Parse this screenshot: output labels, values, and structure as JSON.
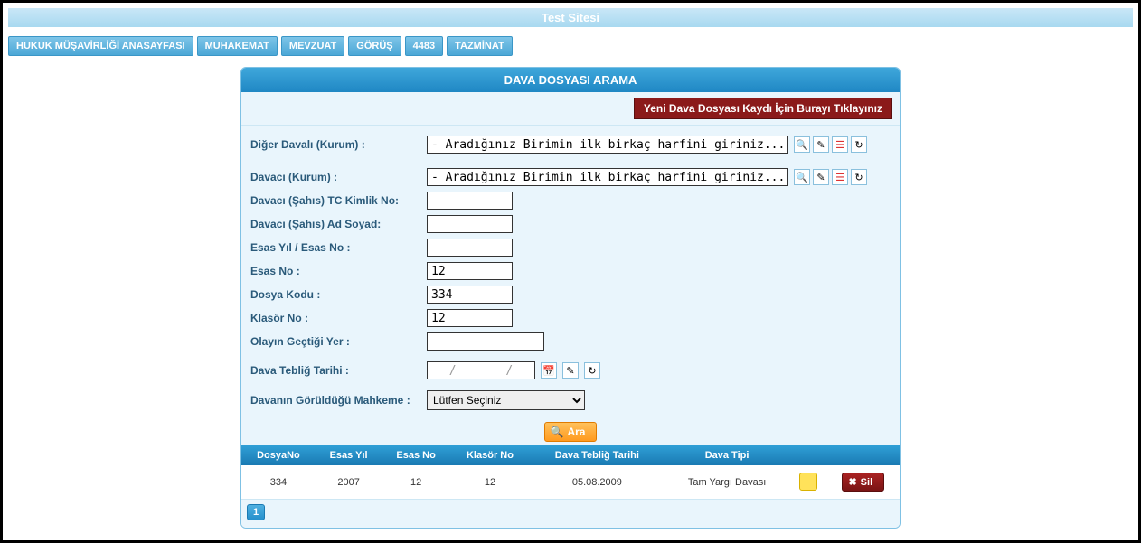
{
  "site_title": "Test Sitesi",
  "nav": [
    "HUKUK MÜŞAVİRLİĞİ ANASAYFASI",
    "MUHAKEMAT",
    "MEVZUAT",
    "GÖRÜŞ",
    "4483",
    "TAZMİNAT"
  ],
  "panel_title": "DAVA DOSYASI ARAMA",
  "new_record_label": "Yeni Dava Dosyası Kaydı İçin Burayı Tıklayınız",
  "form": {
    "diger_davali": {
      "label": "Diğer Davalı (Kurum) :",
      "value": "- Aradığınız Birimin ilk birkaç harfini giriniz..."
    },
    "davaci_kurum": {
      "label": "Davacı (Kurum) :",
      "value": "- Aradığınız Birimin ilk birkaç harfini giriniz..."
    },
    "tc_kimlik": {
      "label": "Davacı (Şahıs) TC Kimlik No:",
      "value": ""
    },
    "ad_soyad": {
      "label": "Davacı (Şahıs) Ad Soyad:",
      "value": ""
    },
    "esas_yil_no": {
      "label": "Esas Yıl / Esas No :",
      "value": ""
    },
    "esas_no": {
      "label": "Esas No :",
      "value": "12"
    },
    "dosya_kodu": {
      "label": "Dosya Kodu :",
      "value": "334"
    },
    "klasor_no": {
      "label": "Klasör No :",
      "value": "12"
    },
    "olay_yer": {
      "label": "Olayın Geçtiği Yer :",
      "value": ""
    },
    "teblig_tarihi": {
      "label": "Dava Tebliğ Tarihi :",
      "value": "/       /"
    },
    "mahkeme": {
      "label": "Davanın Görüldüğü Mahkeme :",
      "selected": "Lütfen Seçiniz"
    }
  },
  "search_label": "Ara",
  "results": {
    "headers": [
      "DosyaNo",
      "Esas Yıl",
      "Esas No",
      "Klasör No",
      "Dava Tebliğ Tarihi",
      "Dava Tipi"
    ],
    "rows": [
      {
        "dosya_no": "334",
        "esas_yil": "2007",
        "esas_no": "12",
        "klasor_no": "12",
        "teblig": "05.08.2009",
        "tipi": "Tam Yargı Davası"
      }
    ]
  },
  "delete_label": "Sil",
  "page_current": "1"
}
